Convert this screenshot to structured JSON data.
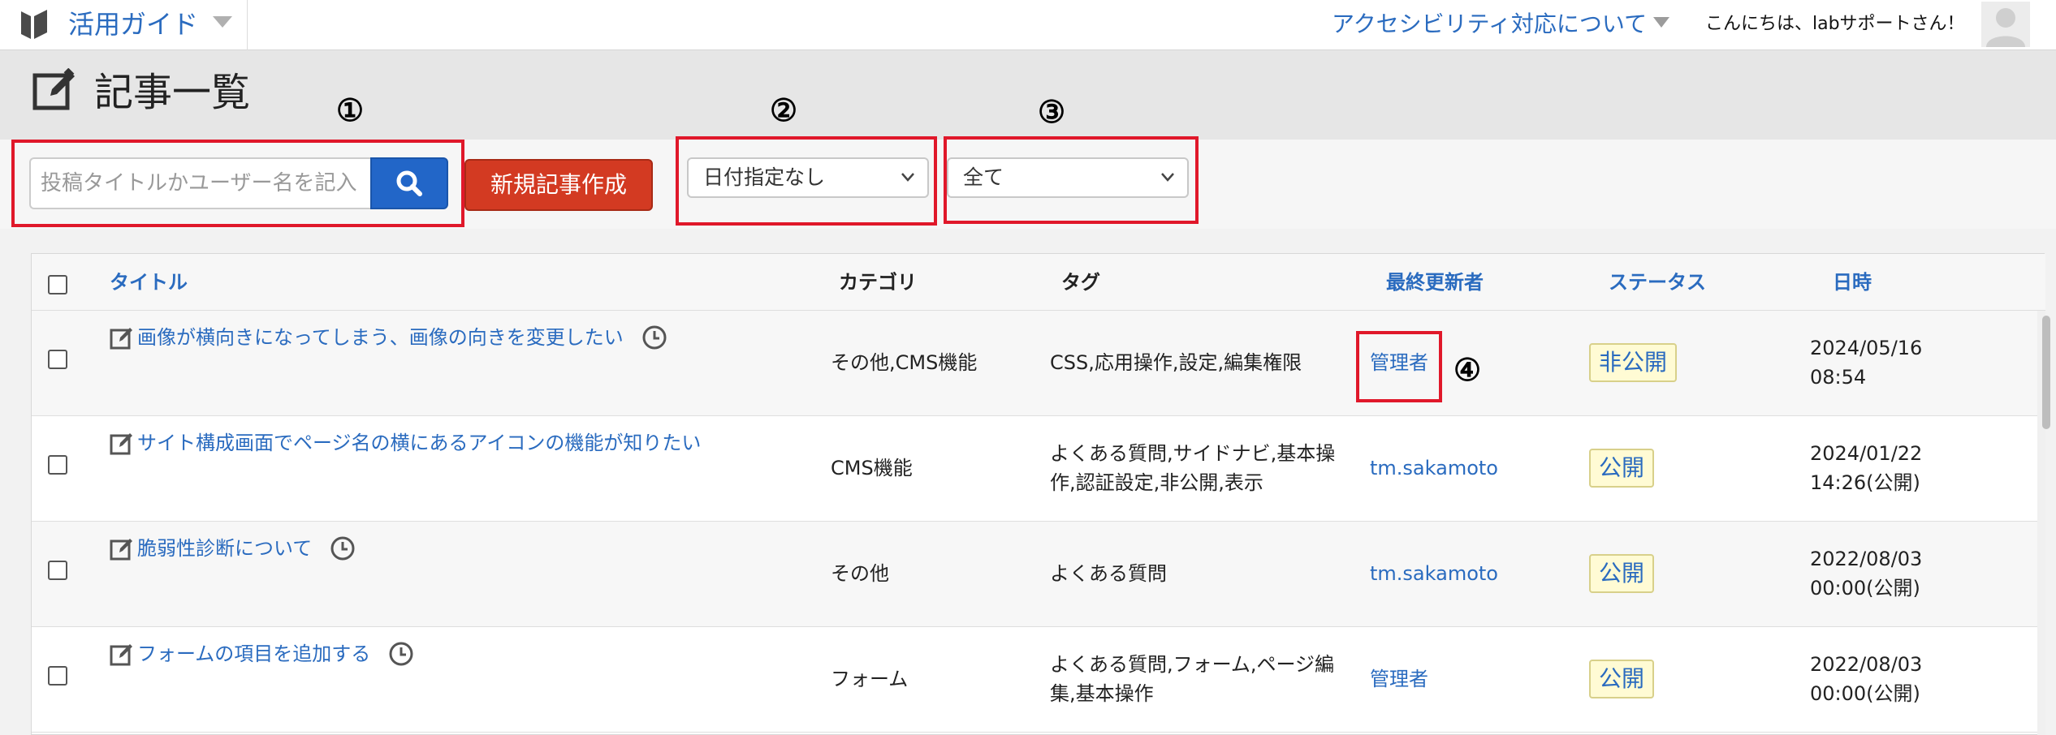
{
  "topbar": {
    "brand_title": "活用ガイド",
    "accessibility_link": "アクセシビリティ対応について",
    "greeting": "こんにちは、labサポートさん！"
  },
  "header": {
    "title": "記事一覧"
  },
  "toolbar": {
    "search_placeholder": "投稿タイトルかユーザー名を記入",
    "new_article_label": "新規記事作成",
    "date_filter_value": "日付指定なし",
    "status_filter_value": "全て"
  },
  "annotations": [
    "①",
    "②",
    "③",
    "④"
  ],
  "table": {
    "columns": {
      "title": "タイトル",
      "category": "カテゴリ",
      "tags": "タグ",
      "updater": "最終更新者",
      "status": "ステータス",
      "date": "日時"
    },
    "rows": [
      {
        "title": "画像が横向きになってしまう、画像の向きを変更したい",
        "category": "その他,CMS機能",
        "tags_line1": "CSS,応用操作,設定,編集権限",
        "tags_line2": "",
        "updater": "管理者",
        "status": "非公開",
        "date_line1": "2024/05/16",
        "date_line2": "08:54"
      },
      {
        "title": "サイト構成画面でページ名の横にあるアイコンの機能が知りたい",
        "category": "CMS機能",
        "tags_line1": "よくある質問,サイドナビ,基本操",
        "tags_line2": "作,認証設定,非公開,表示",
        "updater": "tm.sakamoto",
        "status": "公開",
        "date_line1": "2024/01/22",
        "date_line2": "14:26(公開)"
      },
      {
        "title": "脆弱性診断について",
        "category": "その他",
        "tags_line1": "よくある質問",
        "tags_line2": "",
        "updater": "tm.sakamoto",
        "status": "公開",
        "date_line1": "2022/08/03",
        "date_line2": "00:00(公開)"
      },
      {
        "title": "フォームの項目を追加する",
        "category": "フォーム",
        "tags_line1": "よくある質問,フォーム,ページ編",
        "tags_line2": "集,基本操作",
        "updater": "管理者",
        "status": "公開",
        "date_line1": "2022/08/03",
        "date_line2": "00:00(公開)"
      }
    ]
  },
  "colors": {
    "link": "#2a6bbf",
    "accent_red": "#d33a22",
    "search_blue": "#2266c8",
    "annotation_red": "#e0182a",
    "status_bg": "#fffbd4"
  }
}
